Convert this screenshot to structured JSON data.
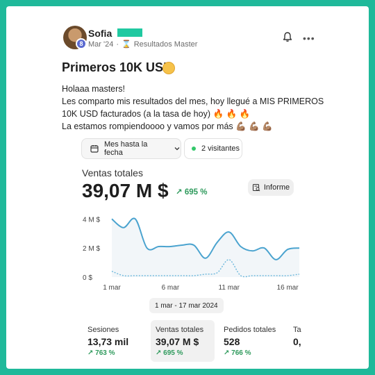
{
  "post": {
    "author_name": "Sofia",
    "level": "8",
    "date": "Mar '24",
    "separator": "·",
    "community": "Resultados Master",
    "title": "Primeros 10K USD",
    "body_lines": [
      "Holaaa masters!",
      "Les comparto mis resultados del mes, hoy llegué a MIS PRIMEROS",
      "10K USD facturados (a la tasa de hoy) 🔥 🔥 🔥",
      "La estamos rompiendoooo y vamos por más 💪🏽 💪🏽 💪🏽"
    ]
  },
  "icons": {
    "notifications": "bell-icon",
    "more": "more-options-icon",
    "calendar": "calendar-icon",
    "report": "report-icon",
    "trend": "trend-up-arrow-icon",
    "emoji_title": "smiling-face-emoji",
    "emoji_fire": "fire-emoji",
    "emoji_muscle": "flexed-biceps-emoji"
  },
  "controls": {
    "date_range_label": "Mes hasta la fecha",
    "visitors_label": "2 visitantes"
  },
  "metric": {
    "label": "Ventas totales",
    "value": "39,07 M $",
    "change": "↗ 695 %",
    "report_label": "Informe"
  },
  "range_label": "1 mar - 17 mar 2024",
  "colors": {
    "accent_green": "#2e9a5c",
    "line_blue": "#4aa3cf",
    "frame": "#1fb99a"
  },
  "chart_data": {
    "type": "line",
    "x": [
      1,
      2,
      3,
      4,
      5,
      6,
      7,
      8,
      9,
      10,
      11,
      12,
      13,
      14,
      15,
      16,
      17
    ],
    "x_tick_labels": [
      "1 mar",
      "6 mar",
      "11 mar",
      "16 mar"
    ],
    "x_ticks": [
      1,
      6,
      11,
      16
    ],
    "y_tick_labels": [
      "4 M $",
      "2 M $",
      "0 $"
    ],
    "y_ticks": [
      4,
      2,
      0
    ],
    "ylim": [
      0,
      4.3
    ],
    "series": [
      {
        "style": "solid",
        "values": [
          4.0,
          3.4,
          4.0,
          2.0,
          2.1,
          2.1,
          2.2,
          2.2,
          1.3,
          2.4,
          3.1,
          2.1,
          1.8,
          2.0,
          1.2,
          1.9,
          2.0
        ]
      },
      {
        "style": "dashed",
        "values": [
          0.4,
          0.1,
          0.1,
          0.1,
          0.1,
          0.1,
          0.1,
          0.1,
          0.2,
          0.3,
          1.2,
          0.1,
          0.1,
          0.1,
          0.1,
          0.1,
          0.2
        ]
      }
    ]
  },
  "stats": [
    {
      "label": "Sesiones",
      "value": "13,73 mil",
      "change": "↗ 763 %"
    },
    {
      "label": "Ventas totales",
      "value": "39,07 M $",
      "change": "↗ 695 %"
    },
    {
      "label": "Pedidos totales",
      "value": "528",
      "change": "↗ 766 %"
    },
    {
      "label": "Ta",
      "value": "0,",
      "change": ""
    }
  ]
}
